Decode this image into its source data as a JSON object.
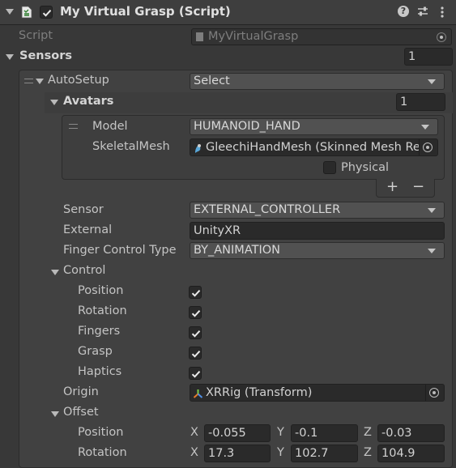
{
  "header": {
    "title": "My Virtual Grasp (Script)",
    "enabled": true
  },
  "script": {
    "label": "Script",
    "value": "MyVirtualGrasp"
  },
  "sensors": {
    "label": "Sensors",
    "count": "1",
    "element": {
      "autosetup_label": "AutoSetup",
      "autosetup_value": "Select",
      "avatars": {
        "label": "Avatars",
        "count": "1",
        "model_label": "Model",
        "model_value": "HUMANOID_HAND",
        "skeletal_label": "SkeletalMesh",
        "skeletal_value": "GleechiHandMesh (Skinned Mesh Re",
        "physical_label": "Physical",
        "plus": "+",
        "minus": "−"
      },
      "sensor_label": "Sensor",
      "sensor_value": "EXTERNAL_CONTROLLER",
      "external_label": "External",
      "external_value": "UnityXR",
      "finger_label": "Finger Control Type",
      "finger_value": "BY_ANIMATION",
      "control": {
        "label": "Control",
        "items": [
          {
            "label": "Position",
            "checked": true
          },
          {
            "label": "Rotation",
            "checked": true
          },
          {
            "label": "Fingers",
            "checked": true
          },
          {
            "label": "Grasp",
            "checked": true
          },
          {
            "label": "Haptics",
            "checked": true
          }
        ]
      },
      "origin_label": "Origin",
      "origin_value": "XRRig (Transform)",
      "offset": {
        "label": "Offset",
        "position_label": "Position",
        "rotation_label": "Rotation",
        "axis_x": "X",
        "axis_y": "Y",
        "axis_z": "Z",
        "position": {
          "x": "-0.055",
          "y": "-0.1",
          "z": "-0.03"
        },
        "rotation": {
          "x": "17.3",
          "y": "102.7",
          "z": "104.9"
        }
      }
    }
  }
}
